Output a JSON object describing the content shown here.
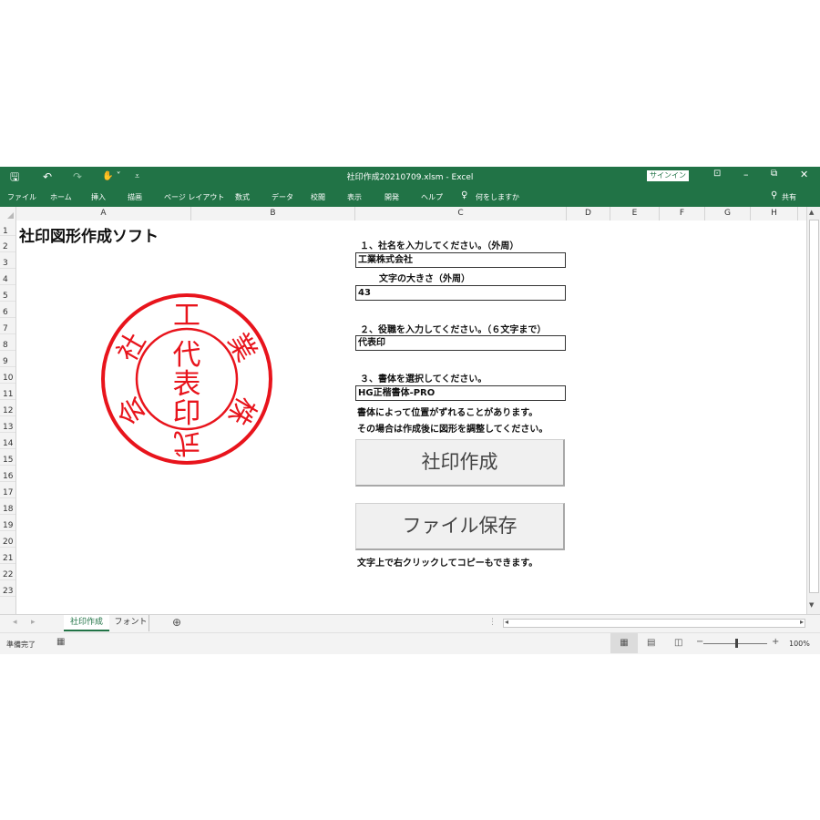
{
  "window": {
    "title": "社印作成20210709.xlsm  -  Excel",
    "signin_label": "サインイン",
    "accent": "#217346"
  },
  "ribbon": {
    "tabs": [
      "ファイル",
      "ホーム",
      "挿入",
      "描画",
      "ページ レイアウト",
      "数式",
      "データ",
      "校閲",
      "表示",
      "開発",
      "ヘルプ"
    ],
    "tell_me": "何をしますか",
    "share": "共有"
  },
  "columns": [
    "A",
    "B",
    "C",
    "D",
    "E",
    "F",
    "G",
    "H"
  ],
  "rows": [
    "1",
    "2",
    "3",
    "4",
    "5",
    "6",
    "7",
    "8",
    "9",
    "10",
    "11",
    "12",
    "13",
    "14",
    "15",
    "16",
    "17",
    "18",
    "19",
    "20",
    "21",
    "22",
    "23"
  ],
  "sheet": {
    "title": "社印図形作成ソフト",
    "step1_label": "１、社名を入力してください。（外周）",
    "company_name": "工業株式会社",
    "size_label": "文字の大きさ（外周）",
    "size_value": "43",
    "step2_label": "２、役職を入力してください。（６文字まで）",
    "position_value": "代表印",
    "step3_label": "３、書体を選択してください。",
    "font_value": "HG正楷書体-PRO",
    "note1": "書体によって位置がずれることがあります。",
    "note2": "その場合は作成後に図形を調整してください。",
    "create_button": "社印作成",
    "save_button": "ファイル保存",
    "footer_note": "文字上で右クリックしてコピーもできます。"
  },
  "stamp": {
    "color": "#e8141c",
    "outer_chars": [
      "株",
      "式",
      "会",
      "社",
      "工",
      "業"
    ],
    "inner_chars": [
      "代",
      "表",
      "印"
    ]
  },
  "tabs": {
    "active": "社印作成",
    "other": "フォント",
    "add": "⊕"
  },
  "status": {
    "ready": "準備完了",
    "zoom": "100%"
  }
}
